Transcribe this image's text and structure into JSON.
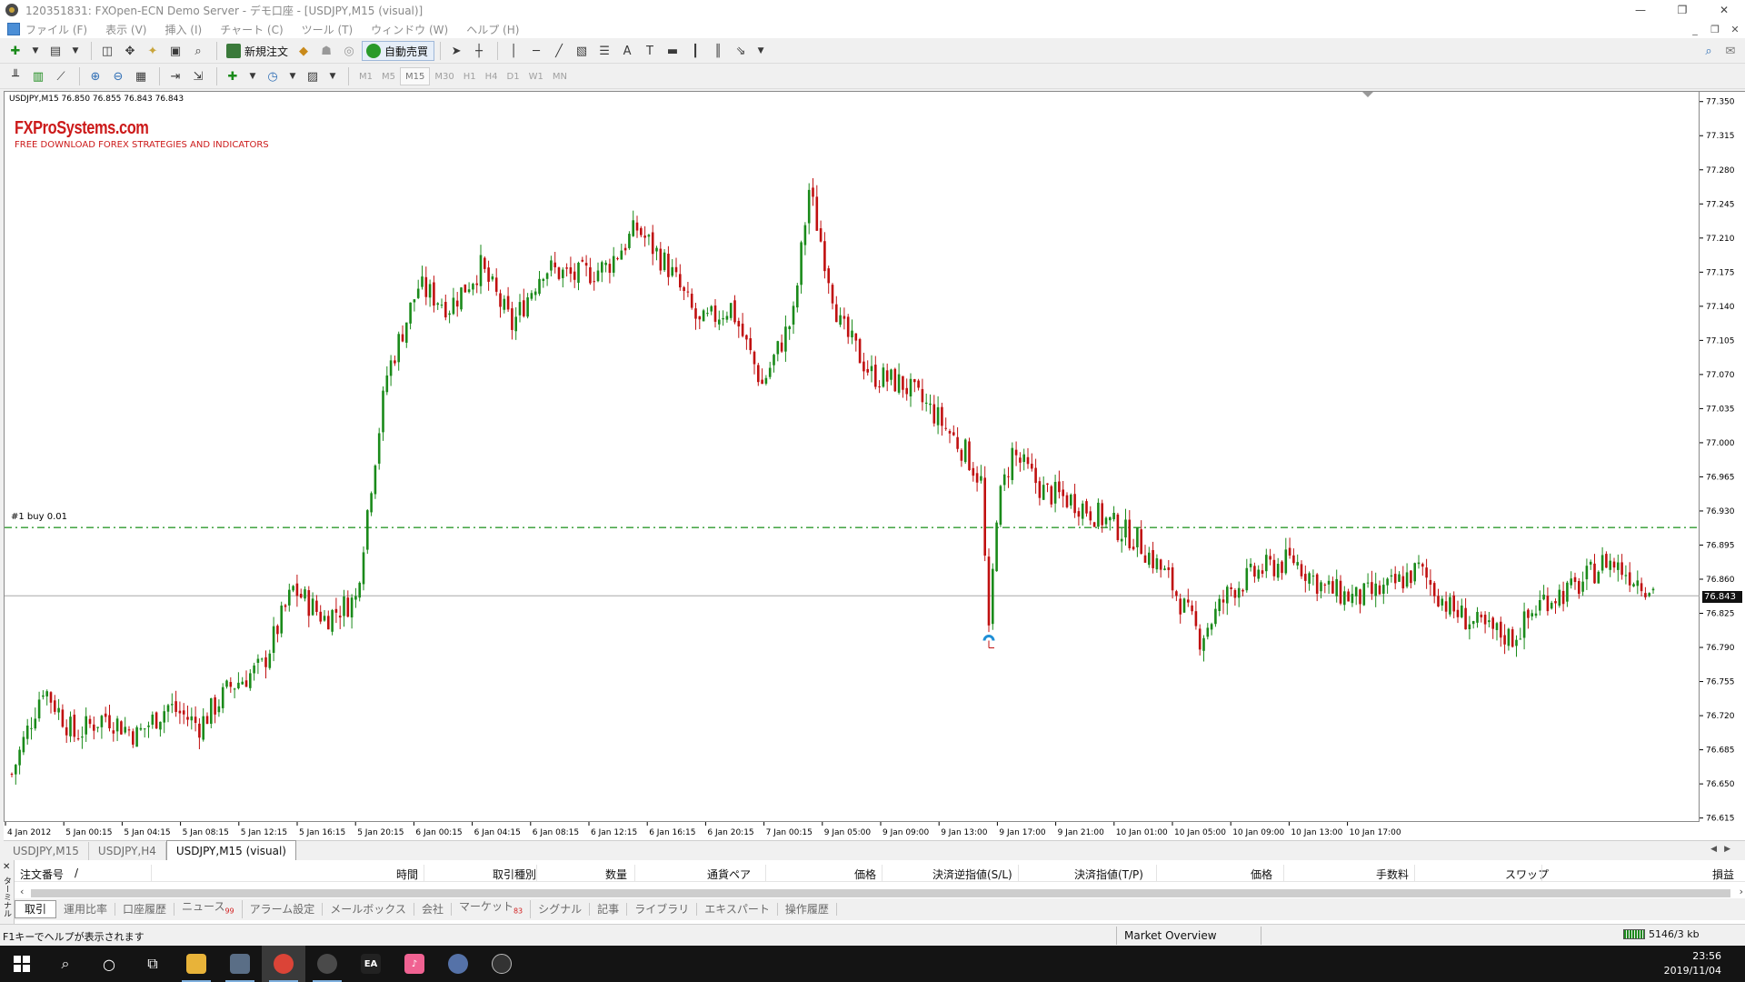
{
  "window": {
    "title": "120351831: FXOpen-ECN Demo Server - デモ口座 - [USDJPY,M15 (visual)]",
    "controls": [
      "—",
      "❐",
      "✕"
    ],
    "mdi_controls": [
      "_",
      "❐",
      "✕"
    ]
  },
  "menu": [
    "ファイル (F)",
    "表示 (V)",
    "挿入 (I)",
    "チャート (C)",
    "ツール (T)",
    "ウィンドウ (W)",
    "ヘルプ (H)"
  ],
  "toolbar": {
    "new_order_label": "新規注文",
    "auto_trading_label": "自動売買",
    "text_tool": "A",
    "text_label_tool": "T",
    "search_icon": "search-icon",
    "chat_icon": "chat-icon"
  },
  "timeframes": [
    "M1",
    "M5",
    "M15",
    "M30",
    "H1",
    "H4",
    "D1",
    "W1",
    "MN"
  ],
  "selected_timeframe": "M15",
  "chart": {
    "symbol_info": "USDJPY,M15  76.850 76.855 76.843 76.843",
    "watermark_brand": "FXProSystems.com",
    "watermark_tagline": "FREE DOWNLOAD FOREX STRATEGIES AND INDICATORS",
    "order_line_label": "#1 buy 0.01",
    "last_price_label": "76.843",
    "colors": {
      "bull": "#1a8a1a",
      "bear": "#c01010",
      "order_line": "#2e9a2e",
      "bid_line": "#a8a8a8"
    }
  },
  "chart_data": {
    "type": "candlestick",
    "symbol": "USDJPY",
    "timeframe": "M15",
    "ohlc_header": {
      "open": 76.85,
      "high": 76.855,
      "low": 76.843,
      "close": 76.843
    },
    "ylim": [
      76.61,
      77.36
    ],
    "price_ticks": [
      "77.350",
      "77.315",
      "77.280",
      "77.245",
      "77.210",
      "77.175",
      "77.140",
      "77.105",
      "77.070",
      "77.035",
      "77.000",
      "76.965",
      "76.930",
      "76.895",
      "76.860",
      "76.825",
      "76.790",
      "76.755",
      "76.720",
      "76.685",
      "76.650",
      "76.615"
    ],
    "time_ticks": [
      "4 Jan 2012",
      "5 Jan 00:15",
      "5 Jan 04:15",
      "5 Jan 08:15",
      "5 Jan 12:15",
      "5 Jan 16:15",
      "5 Jan 20:15",
      "6 Jan 00:15",
      "6 Jan 04:15",
      "6 Jan 08:15",
      "6 Jan 12:15",
      "6 Jan 16:15",
      "6 Jan 20:15",
      "7 Jan 00:15",
      "9 Jan 05:00",
      "9 Jan 09:00",
      "9 Jan 13:00",
      "9 Jan 17:00",
      "9 Jan 21:00",
      "10 Jan 01:00",
      "10 Jan 05:00",
      "10 Jan 09:00",
      "10 Jan 13:00",
      "10 Jan 17:00"
    ],
    "order_level": 76.913,
    "bid_level": 76.843,
    "approx_close_path": [
      [
        0,
        76.66
      ],
      [
        8,
        76.75
      ],
      [
        16,
        76.7
      ],
      [
        24,
        76.72
      ],
      [
        32,
        76.7
      ],
      [
        40,
        76.73
      ],
      [
        48,
        76.71
      ],
      [
        56,
        76.75
      ],
      [
        64,
        76.77
      ],
      [
        72,
        76.85
      ],
      [
        80,
        76.82
      ],
      [
        88,
        76.84
      ],
      [
        92,
        76.96
      ],
      [
        96,
        77.07
      ],
      [
        104,
        77.16
      ],
      [
        112,
        77.14
      ],
      [
        120,
        77.18
      ],
      [
        128,
        77.12
      ],
      [
        136,
        77.18
      ],
      [
        144,
        77.17
      ],
      [
        152,
        77.18
      ],
      [
        160,
        77.22
      ],
      [
        168,
        77.18
      ],
      [
        176,
        77.12
      ],
      [
        184,
        77.14
      ],
      [
        192,
        77.06
      ],
      [
        200,
        77.13
      ],
      [
        204,
        77.26
      ],
      [
        212,
        77.12
      ],
      [
        220,
        77.07
      ],
      [
        228,
        77.06
      ],
      [
        236,
        77.03
      ],
      [
        244,
        76.99
      ],
      [
        248,
        76.96
      ],
      [
        250,
        76.8
      ],
      [
        252,
        76.93
      ],
      [
        256,
        76.99
      ],
      [
        264,
        76.95
      ],
      [
        272,
        76.94
      ],
      [
        280,
        76.92
      ],
      [
        288,
        76.9
      ],
      [
        296,
        76.86
      ],
      [
        304,
        76.8
      ],
      [
        312,
        76.85
      ],
      [
        320,
        76.87
      ],
      [
        328,
        76.88
      ],
      [
        336,
        76.85
      ],
      [
        344,
        76.84
      ],
      [
        352,
        76.85
      ],
      [
        360,
        76.87
      ],
      [
        368,
        76.83
      ],
      [
        376,
        76.81
      ],
      [
        384,
        76.8
      ],
      [
        392,
        76.84
      ],
      [
        400,
        76.85
      ],
      [
        408,
        76.88
      ],
      [
        416,
        76.86
      ],
      [
        420,
        76.85
      ]
    ]
  },
  "chart_tabs": [
    "USDJPY,M15",
    "USDJPY,H4",
    "USDJPY,M15 (visual)"
  ],
  "active_chart_tab": 2,
  "terminal": {
    "side_label": "ターミナル",
    "columns": [
      "注文番号",
      "/",
      "時間",
      "取引種別",
      "数量",
      "通貨ペア",
      "価格",
      "決済逆指値(S/L)",
      "決済指値(T/P)",
      "価格",
      "手数料",
      "スワップ",
      "損益"
    ],
    "tabs": [
      {
        "label": "取引"
      },
      {
        "label": "運用比率"
      },
      {
        "label": "口座履歴"
      },
      {
        "label": "ニュース",
        "badge": "99"
      },
      {
        "label": "アラーム設定"
      },
      {
        "label": "メールボックス"
      },
      {
        "label": "会社"
      },
      {
        "label": "マーケット",
        "badge": "83"
      },
      {
        "label": "シグナル"
      },
      {
        "label": "記事"
      },
      {
        "label": "ライブラリ"
      },
      {
        "label": "エキスパート"
      },
      {
        "label": "操作履歴"
      }
    ],
    "active_tab": 0
  },
  "status": {
    "help": "F1キーでヘルプが表示されます",
    "profile": "Market Overview",
    "traffic": "5146/3 kb"
  },
  "taskbar": {
    "ea_label": "EA",
    "time": "23:56",
    "date": "2019/11/04"
  }
}
